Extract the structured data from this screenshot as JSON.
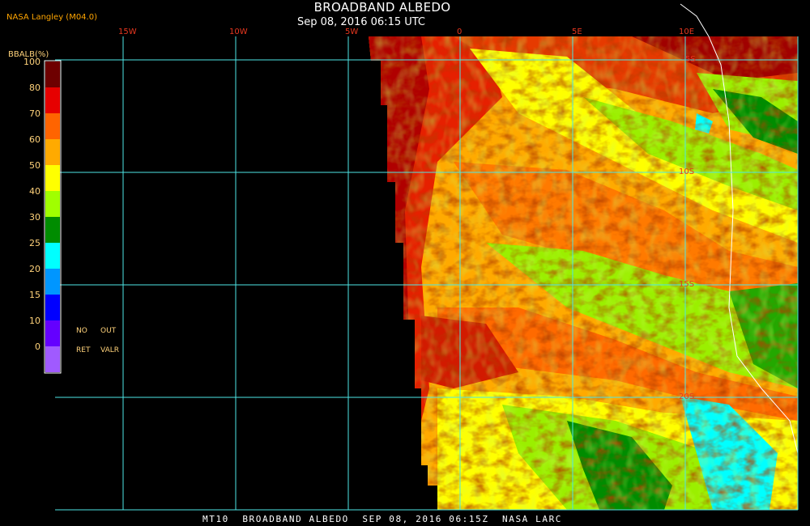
{
  "header": {
    "title": "BROADBAND ALBEDO",
    "subtitle": "Sep 08, 2016 06:15 UTC",
    "agency": "NASA Langley (M04.0)"
  },
  "legend": {
    "title": "BBALB(%)",
    "ticks": [
      "100",
      "80",
      "70",
      "60",
      "50",
      "40",
      "30",
      "25",
      "20",
      "15",
      "10",
      "0"
    ],
    "colors": [
      "#6e0000",
      "#e60000",
      "#ff6400",
      "#ffaa00",
      "#ffff00",
      "#a0ff00",
      "#008c00",
      "#00ffff",
      "#0096ff",
      "#0000ff",
      "#6400ff",
      "#a05aff"
    ],
    "no_ret": [
      "NO",
      "RET"
    ],
    "out_valr": [
      "OUT",
      "VALR"
    ]
  },
  "grid": {
    "lon_labels": [
      "15W",
      "10W",
      "5W",
      "0",
      "5E",
      "10E"
    ],
    "lat_labels": [
      "5S",
      "10S",
      "15S",
      "20S"
    ],
    "line_color": "#4ee6e6"
  },
  "footer": "MT10  BROADBAND ALBEDO  SEP 08, 2016 06:15Z  NASA LARC"
}
